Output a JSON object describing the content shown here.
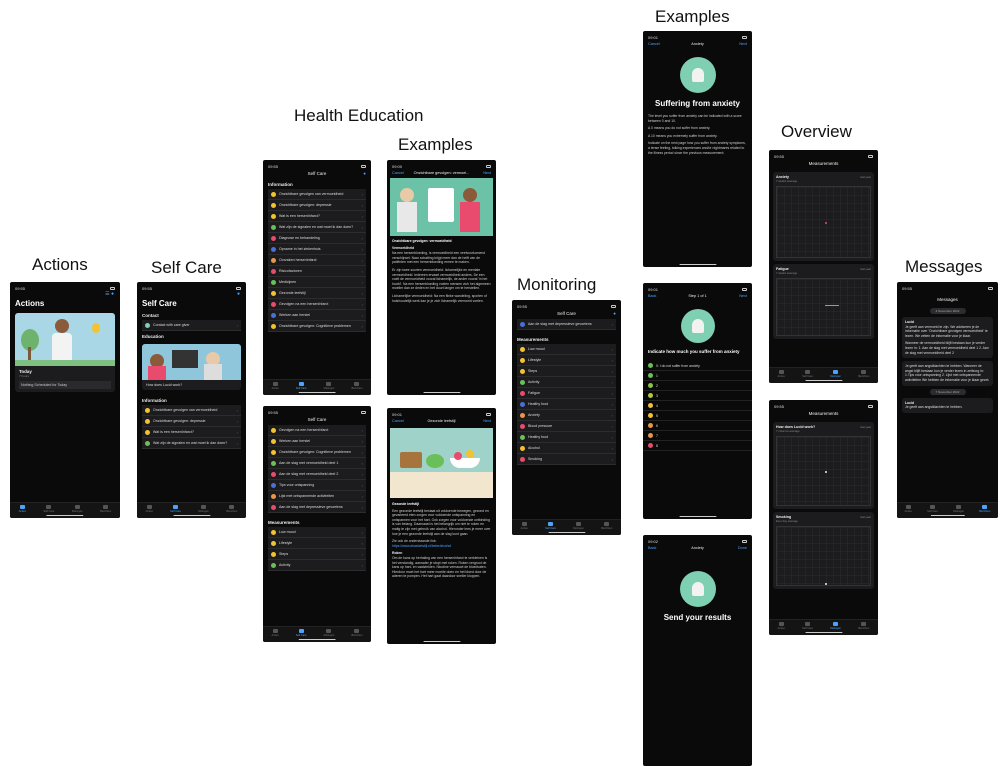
{
  "labels": {
    "actions": "Actions",
    "self_care": "Self Care",
    "health_education": "Health Education",
    "examples_1": "Examples",
    "monitoring": "Monitoring",
    "examples_2": "Examples",
    "overview": "Overview",
    "messages": "Messages"
  },
  "status": {
    "t1": "09:55",
    "t2": "09:00",
    "t3": "09:01",
    "t4": "09:02"
  },
  "tabs": [
    "Acties",
    "Self Care",
    "Metingen",
    "Berichten"
  ],
  "actions_screen": {
    "title": "Actions",
    "today": "Today",
    "sub": "7 hours",
    "nothing": "Nothing Scheduled for Today"
  },
  "selfcare_screen": {
    "title": "Self Care",
    "contact": "Contact",
    "contact_btn": "Contact with care giver",
    "education": "Education",
    "edu_card": "How does Lucid work?",
    "information": "Information",
    "items": [
      "Onzichtbare gevolgen van vermoeidheid",
      "Onzichtbare gevolgen: depressie",
      "Wat is een hersenïnfarct?",
      "Wat zijn de signalen en wat moet ik dan doen?"
    ]
  },
  "health_edu_1": {
    "nav": "Self Care",
    "section": "Information",
    "items": [
      "Onzichtbare gevolgen van vermoeidheid",
      "Onzichtbare gevolgen: depressie",
      "Wat is een hersenïnfarct?",
      "Wat zijn de signalen en wat moet ik dan doen?",
      "Diagnose en behandeling",
      "Opname in het ziekenhuis",
      "Oorzaken hersenïnfarct",
      "Risicofactoren",
      "Medicijnen",
      "Gezonde leefstijl",
      "Gevolgen na een hersenïnfarct",
      "Werken aan herstel",
      "Onzichtbare gevolgen: Cognitieve problemen"
    ]
  },
  "health_edu_2": {
    "nav": "Self Care",
    "items": [
      "Gevolgen na een hersenïnfarct",
      "Werken aan herstel",
      "Onzichtbare gevolgen: Cognitieve problemen",
      "Aan de slag met vermoeidheid deel 1",
      "Aan de slag met vermoeidheid deel 2",
      "Tips voor ontspanning",
      "Lijst met ontspannende activiteiten",
      "Aan de slag met depressieve gevoelens"
    ],
    "measurements": "Measurements",
    "meas_items": [
      "Low mood",
      "Lifestyle",
      "Steps",
      "Activity"
    ]
  },
  "example_1": {
    "cancel": "Cancel",
    "nav": "Onzichtbare gevolgen: vermoei...",
    "next": "Next",
    "heading": "Onzichtbare gevolgen: vermoeidheid",
    "sub": "Vermoeidheid",
    "p1": "Na een hersenbloeding, is vermoeidheid een veelvoorkomend verschijnsel. Naar schatting krijgt meer dan de helft van de patiënten met een hersenbloeding ermee te maken.",
    "p2": "Er zijn twee soorten vermoeidheid: lichamelijke en mentale vermoeidheid. Iedereen ervaart vermoeidheid anders. De een voelt de vermoeidheid vooral lichamelijk, de ander vooral 'in het hoofd'. Na een hersenbloeding voelen mensen zich het algemeen moeiler dan ze deden en het duurt langer om te herstellen.",
    "p3": "Lichamelijke vermoeidheid: Na een flinke wandeling, sporten of huishoudelijk werk kan je je zich lichamelijk vermoeid voelen."
  },
  "example_2": {
    "cancel": "Cancel",
    "nav": "Gezonde leefstijl",
    "next": "Next",
    "heading": "Gezonde leefstijl",
    "p1": "Een gezonde leefstijl bestaat uit voldoende bewegen, gezond en gevarieerd eten zorgen voor voldoende ontspanning en ontspannen voor het hart. Ook zorgen voor voldoende ontbinding is van belang. Daarnaast is het belangrijk om niet te roken en matig te zijn met gebruik van alcohol. Hieronder lees je meer over hoe je een gezonde leefstijl aan de slag kunt gaan.",
    "p2": "Zie ook de onderstaande link:",
    "link": "https://www.ahasbetstijl.nl/beter/alcohol",
    "sub": "Roken",
    "p3": "Om de kans op herhaling van een hersenïnfarct te verkleinen is het verstandig, aanrader je stopt met roken. Roken vergroot de kans op hart- en vaatziekten. Nicotine vernauwt de bloedvaten. Hierdoor moet het hart meer moeite doen en het bloed door de aderen te pompen. Het hart gaat daardoor sneller kloppen."
  },
  "monitoring_screen": {
    "nav": "Self Care",
    "top_item": "Aan de slag met depressieve gevoelens",
    "measurements": "Measurements",
    "items": [
      "Low mood",
      "Lifestyle",
      "Steps",
      "Activity",
      "Fatigue",
      "Healthy food",
      "Anxiety",
      "Blood pressure",
      "Healthy food",
      "Alcohol",
      "Smoking"
    ]
  },
  "anxiety_1": {
    "cancel": "Cancel",
    "nav": "Anxiety",
    "next": "Next",
    "heading": "Suffering from anxiety",
    "p1": "The level you suffer from anxiety can be indicated with a score between 0 and 10.",
    "p2": "A 0 means you do not suffer from anxiety.",
    "p3": "A 10 means you extremely suffer from anxiety.",
    "p4": "Indicate on the next page how you suffer from anxiety symptoms, a tense feeling, tolking experiences and/or nightmares related to the illness period since the previous measurement."
  },
  "anxiety_2": {
    "back": "Back",
    "nav": "Step 1 of 1",
    "next": "Next",
    "question": "Indicate how much you suffer from anxiety",
    "options": [
      "0: I do not suffer from anxiety",
      "1",
      "2",
      "3",
      "4",
      "5",
      "6",
      "7",
      "8"
    ]
  },
  "anxiety_3": {
    "back": "Back",
    "nav": "Anxiety",
    "done": "Done",
    "heading": "Send your results"
  },
  "overview_1": {
    "nav": "Measurements",
    "c1_title": "Anxiety",
    "c1_sub": "7 weeks average",
    "c2_title": "Fatigue",
    "c2_sub": "7 weeks average",
    "range": "last year"
  },
  "overview_2": {
    "nav": "Measurements",
    "c1_title": "How does Lucid work?",
    "c1_sub": "7 columns average",
    "c2_title": "Smoking",
    "c2_sub": "Ever day average",
    "range": "last year"
  },
  "messages_screen": {
    "nav": "Messages",
    "date1": "4 November 2022",
    "sender": "Lucid",
    "m1": "Je geeft aan vermoeid te zijn. We adviseren je de informatie over 'Onzichtbare gevolgen vermoeidheid' te lezen. We zetten de informatie voor je klaar.",
    "m2": "Wanneer de vermoeidheid blijft bestaan kun je verder lezen in: 1. Aan de slag met vermoeidheid deel 1  2. Aan de slag met vermoeidheid deel 2",
    "m3": "Je geeft aan angstklachten te hebben. Wanneer de angst blijft bestaan kun je verder lezen in zelfzorg in: 1.Tips voor ontspanning  2. Lijst met ontspannende activiteiten We hebben de informatie voor je klaar gezet.",
    "date2": "7 November 2022",
    "m4": "Je geeft aan angstklachten te hebben."
  },
  "colors": {
    "accent": "#4aa3ff",
    "mint": "#7fcfb2",
    "card": "#1c1c1e",
    "screen": "#0a0a0a"
  }
}
